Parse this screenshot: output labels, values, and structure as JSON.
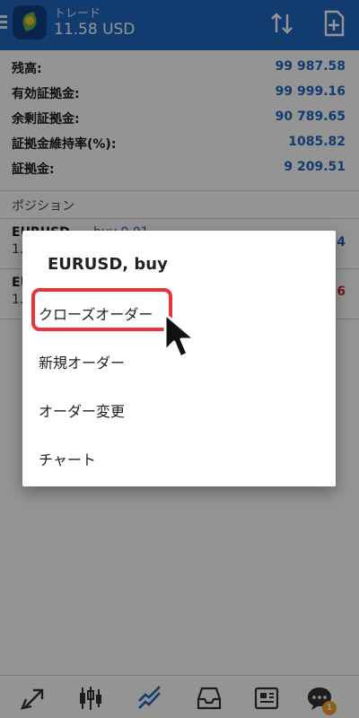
{
  "header": {
    "title": "トレード",
    "balance": "11.58 USD"
  },
  "summary": [
    {
      "label": "残高:",
      "value": "99 987.58"
    },
    {
      "label": "有効証拠金:",
      "value": "99 999.16"
    },
    {
      "label": "余剰証拠金:",
      "value": "90 789.65"
    },
    {
      "label": "証拠金維持率(%):",
      "value": "1085.82"
    },
    {
      "label": "証拠金:",
      "value": "9 209.51"
    }
  ],
  "positions_section": "ポジション",
  "positions": [
    {
      "symbol": "EURUSD",
      "type": "buy 0.01",
      "price": "1.",
      "profit": "34",
      "profit_color": "#1f66c1"
    },
    {
      "symbol": "EURUSD",
      "type": "",
      "price": "1.",
      "profit": "26",
      "profit_color": "#d0263a"
    }
  ],
  "dialog": {
    "title": "EURUSD, buy",
    "items": [
      "クローズオーダー",
      "新規オーダー",
      "オーダー変更",
      "チャート"
    ]
  },
  "nav": {
    "badge": "1"
  },
  "colors": {
    "header": "#1f66c1",
    "value_blue": "#1f66c1",
    "loss_red": "#d0263a",
    "highlight": "#e8343b"
  },
  "icons": [
    "menu-icon",
    "app-logo",
    "sort-icon",
    "new-order-icon",
    "trade-nav-icon",
    "quotes-icon",
    "chart-nav-icon",
    "history-icon",
    "news-icon",
    "chat-icon",
    "cursor-icon"
  ]
}
